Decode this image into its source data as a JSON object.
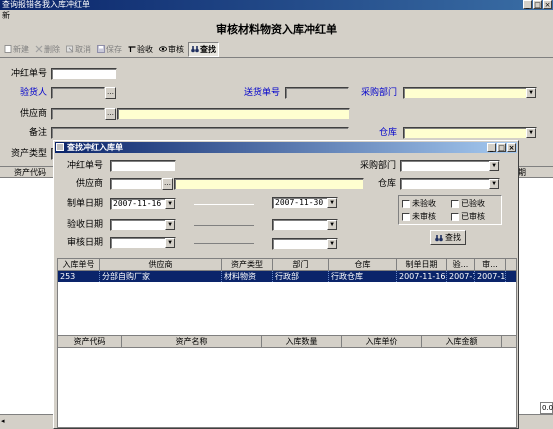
{
  "window": {
    "title": "查询报错各我入库冲红单"
  },
  "menu": {
    "label": "新"
  },
  "page": {
    "heading": "审核材料物资入库冲红单"
  },
  "toolbar": [
    {
      "label": "新建",
      "icon": "new-icon",
      "state": "disabled"
    },
    {
      "label": "删除",
      "icon": "delete-icon",
      "state": "disabled"
    },
    {
      "label": "取消",
      "icon": "cancel-icon",
      "state": "disabled"
    },
    {
      "label": "保存",
      "icon": "save-icon",
      "state": "disabled"
    },
    {
      "label": "验收",
      "icon": "accept-icon",
      "state": "enabled"
    },
    {
      "label": "审核",
      "icon": "eye-icon",
      "state": "enabled"
    },
    {
      "label": "查找",
      "icon": "binoculars-icon",
      "state": "active"
    }
  ],
  "form": {
    "red_no_label": "冲红单号",
    "inspector_label": "验货人",
    "delivery_no_label": "送货单号",
    "purchase_dept_label": "采购部门",
    "supplier_label": "供应商",
    "remark_label": "备注",
    "warehouse_label": "仓库",
    "asset_type_label": "资产类型"
  },
  "main_grid": {
    "col1": "资产代码",
    "col_last": "期"
  },
  "status": {
    "right_value": "0.0"
  },
  "dialog": {
    "title": "查找冲红入库单",
    "red_no_label": "冲红单号",
    "supplier_label": "供应商",
    "make_date_label": "制单日期",
    "make_date_from": "2007-11-16",
    "make_date_to": "2007-11-30",
    "accept_date_label": "验收日期",
    "audit_date_label": "审核日期",
    "purchase_dept_label": "采购部门",
    "warehouse_label": "仓库",
    "checks": [
      "未验收",
      "已验收",
      "未审核",
      "已审核"
    ],
    "find_button": "查找",
    "result_columns": [
      "入库单号",
      "供应商",
      "资产类型",
      "部门",
      "仓库",
      "制单日期",
      "验...",
      "审..."
    ],
    "result_rows": [
      [
        "253",
        "分部自购厂家",
        "材料物资",
        "行政部",
        "行政仓库",
        "2007-11-16",
        "2007-1",
        "2007-1"
      ]
    ],
    "detail_columns": [
      "资产代码",
      "资产名称",
      "入库数量",
      "入库单价",
      "入库金额"
    ]
  }
}
